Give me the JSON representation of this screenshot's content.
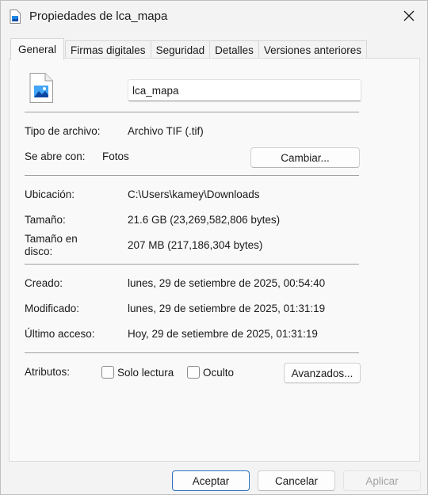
{
  "window": {
    "title": "Propiedades de lca_mapa",
    "close_label": "✕"
  },
  "tabs": [
    {
      "label": "General",
      "active": true
    },
    {
      "label": "Firmas digitales",
      "active": false
    },
    {
      "label": "Seguridad",
      "active": false
    },
    {
      "label": "Detalles",
      "active": false
    },
    {
      "label": "Versiones anteriores",
      "active": false
    }
  ],
  "general": {
    "file_name": "lca_mapa",
    "type_label": "Tipo de archivo:",
    "type_value": "Archivo TIF (.tif)",
    "opens_label": "Se abre con:",
    "opens_value": "Fotos",
    "change_button": "Cambiar...",
    "location_label": "Ubicación:",
    "location_value": "C:\\Users\\kamey\\Downloads",
    "size_label": "Tamaño:",
    "size_value": "21.6 GB (23,269,582,806 bytes)",
    "disk_size_label": "Tamaño en disco:",
    "disk_size_value": "207 MB (217,186,304 bytes)",
    "created_label": "Creado:",
    "created_value": "lunes, 29 de setiembre de 2025, 00:54:40",
    "modified_label": "Modificado:",
    "modified_value": "lunes, 29 de setiembre de 2025, 01:31:19",
    "accessed_label": "Último acceso:",
    "accessed_value": "Hoy, 29 de setiembre de 2025, 01:31:19",
    "attributes_label": "Atributos:",
    "readonly_label": "Solo lectura",
    "readonly_checked": false,
    "hidden_label": "Oculto",
    "hidden_checked": false,
    "advanced_button": "Avanzados..."
  },
  "footer": {
    "ok": "Aceptar",
    "cancel": "Cancelar",
    "apply": "Aplicar"
  },
  "icons": {
    "title": "image-file-icon",
    "file": "image-file-icon",
    "close": "close-icon"
  },
  "colors": {
    "accent": "#2a6fbf",
    "icon_blue": "#1e88e5"
  }
}
